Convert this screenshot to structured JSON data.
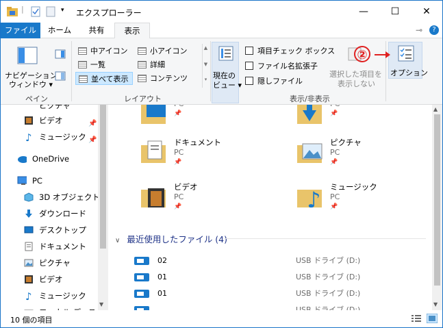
{
  "window": {
    "title": "エクスプローラー",
    "minimize_glyph": "—",
    "maximize_glyph": "☐",
    "close_glyph": "✕"
  },
  "ribbon_tabs": {
    "file": "ファイル",
    "home": "ホーム",
    "share": "共有",
    "view": "表示",
    "pin_glyph": "⊸",
    "help_glyph": "?"
  },
  "ribbon": {
    "pane": {
      "nav_pane_line1": "ナビゲーション",
      "nav_pane_line2": "ウィンドウ ▾",
      "group_label": "ペイン"
    },
    "layout": {
      "items": [
        {
          "label": "中アイコン"
        },
        {
          "label": "小アイコン"
        },
        {
          "label": "一覧"
        },
        {
          "label": "詳細"
        },
        {
          "label": "並べて表示",
          "selected": true
        },
        {
          "label": "コンテンツ"
        }
      ],
      "group_label": "レイアウト"
    },
    "current_view": {
      "line1": "現在の",
      "line2": "ビュー ▾"
    },
    "show_hide": {
      "checkboxes": [
        {
          "label": "項目チェック ボックス",
          "checked": false
        },
        {
          "label": "ファイル名拡張子",
          "checked": false
        },
        {
          "label": "隠しファイル",
          "checked": false
        }
      ],
      "hide_selected_line1": "選択した項目を",
      "hide_selected_line2": "表示しない",
      "group_label": "表示/非表示"
    },
    "options": {
      "label": "オプション"
    }
  },
  "annotation": {
    "number": "②",
    "color": "#e02020"
  },
  "nav": {
    "items": [
      {
        "label": "ビデオ",
        "icon": "video-icon",
        "pinned": true
      },
      {
        "label": "ミュージック",
        "icon": "music-icon",
        "pinned": true
      },
      {
        "label": "OneDrive",
        "icon": "cloud-icon",
        "pinned": false
      },
      {
        "label": "PC",
        "icon": "pc-icon",
        "pinned": false
      },
      {
        "label": "3D オブジェクト",
        "icon": "3d-objects-icon",
        "pinned": false
      },
      {
        "label": "ダウンロード",
        "icon": "download-icon",
        "pinned": false
      },
      {
        "label": "デスクトップ",
        "icon": "desktop-icon",
        "pinned": false
      },
      {
        "label": "ドキュメント",
        "icon": "document-icon",
        "pinned": false
      },
      {
        "label": "ピクチャ",
        "icon": "picture-icon",
        "pinned": false
      },
      {
        "label": "ビデオ",
        "icon": "video-icon",
        "pinned": false
      },
      {
        "label": "ミュージック",
        "icon": "music-icon",
        "pinned": false
      },
      {
        "label": "ローカル ディスク (C",
        "icon": "disk-icon",
        "pinned": false
      }
    ],
    "partial_top_label": "ピクチャ"
  },
  "content": {
    "tiles": [
      {
        "name": "",
        "sub": "PC",
        "icon": "desktop-folder-icon"
      },
      {
        "name": "",
        "sub": "PC",
        "icon": "download-folder-icon"
      },
      {
        "name": "ドキュメント",
        "sub": "PC",
        "icon": "document-folder-icon"
      },
      {
        "name": "ピクチャ",
        "sub": "PC",
        "icon": "picture-folder-icon"
      },
      {
        "name": "ビデオ",
        "sub": "PC",
        "icon": "video-folder-icon"
      },
      {
        "name": "ミュージック",
        "sub": "PC",
        "icon": "music-folder-icon"
      }
    ],
    "pin_glyph": "📌",
    "recent_header": "最近使用したファイル (4)",
    "recent_files": [
      {
        "name": "02",
        "location": "USB ドライブ (D:)"
      },
      {
        "name": "01",
        "location": "USB ドライブ (D:)"
      },
      {
        "name": "01",
        "location": "USB ドライブ (D:)"
      },
      {
        "name": "",
        "location": "USB ドライブ (D:)"
      }
    ]
  },
  "status": {
    "item_count": "10 個の項目"
  },
  "colors": {
    "accent": "#1979ca",
    "folder": "#e9c46a",
    "selected": "#cce8ff"
  }
}
